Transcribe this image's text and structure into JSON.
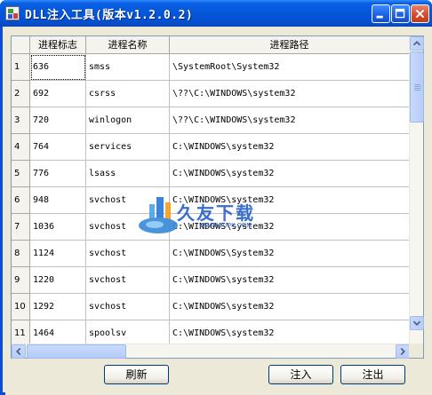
{
  "window": {
    "title": "DLL注入工具(版本v1.2.0.2)"
  },
  "table": {
    "columns": [
      "进程标志",
      "进程名称",
      "进程路径"
    ],
    "rows": [
      {
        "num": "1",
        "pid": "636",
        "name": "smss",
        "path": "\\SystemRoot\\System32"
      },
      {
        "num": "2",
        "pid": "692",
        "name": "csrss",
        "path": "\\??\\C:\\WINDOWS\\system32"
      },
      {
        "num": "3",
        "pid": "720",
        "name": "winlogon",
        "path": "\\??\\C:\\WINDOWS\\system32"
      },
      {
        "num": "4",
        "pid": "764",
        "name": "services",
        "path": "C:\\WINDOWS\\system32"
      },
      {
        "num": "5",
        "pid": "776",
        "name": "lsass",
        "path": "C:\\WINDOWS\\system32"
      },
      {
        "num": "6",
        "pid": "948",
        "name": "svchost",
        "path": "C:\\WINDOWS\\system32"
      },
      {
        "num": "7",
        "pid": "1036",
        "name": "svchost",
        "path": "C:\\WINDOWS\\system32"
      },
      {
        "num": "8",
        "pid": "1124",
        "name": "svchost",
        "path": "C:\\WINDOWS\\System32"
      },
      {
        "num": "9",
        "pid": "1220",
        "name": "svchost",
        "path": "C:\\WINDOWS\\system32"
      },
      {
        "num": "10",
        "pid": "1292",
        "name": "svchost",
        "path": "C:\\WINDOWS\\system32"
      },
      {
        "num": "11",
        "pid": "1464",
        "name": "spoolsv",
        "path": "C:\\WINDOWS\\system32"
      }
    ]
  },
  "buttons": {
    "refresh": "刷新",
    "inject": "注入",
    "eject": "注出"
  },
  "watermark": {
    "text": "久友下载",
    "sub": "WWW.9UPK.COM"
  },
  "colors": {
    "titlebar": "#0556d8",
    "window_bg": "#ece9d8",
    "close_button": "#d4472a"
  }
}
